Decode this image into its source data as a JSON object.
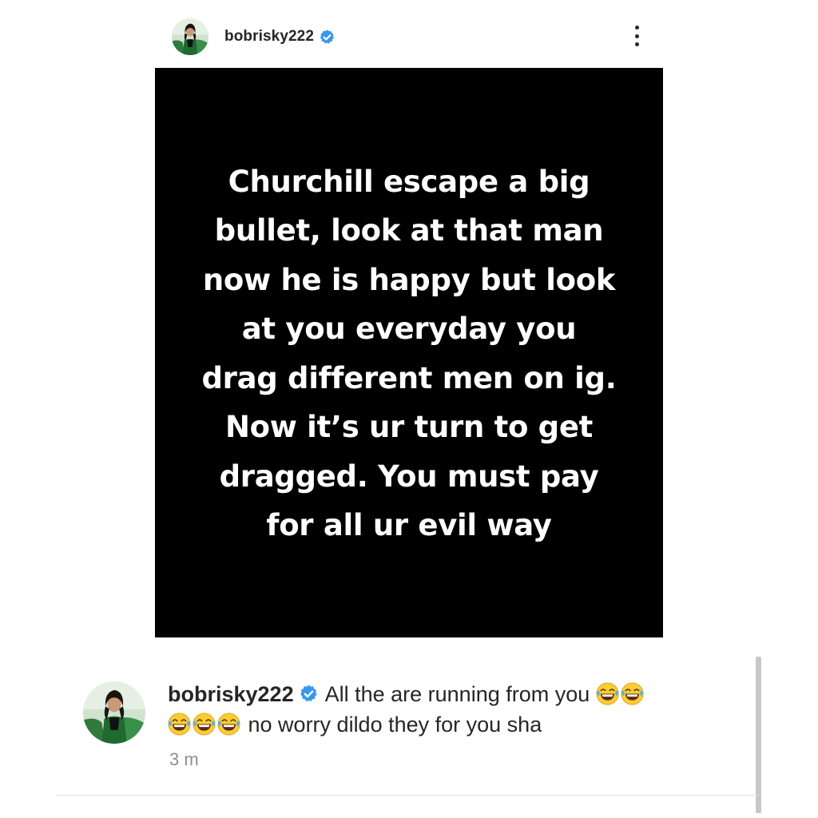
{
  "post": {
    "username": "bobrisky222",
    "verified": true,
    "more_icon": "more-vertical-icon",
    "image_text": "Churchill escape a big\nbullet, look at that man\nnow he is happy but look\nat you everyday you\ndrag different men on ig.\nNow it’s ur turn to get\ndragged. You must pay\nfor all ur evil way",
    "image_background": "#000000",
    "image_text_color": "#ffffff"
  },
  "comment": {
    "username": "bobrisky222",
    "verified": true,
    "text_part1": "All the are running from you",
    "text_part2": "no worry dildo they for you sha",
    "emoji": "face-with-tears-of-joy",
    "timestamp": "3 m"
  },
  "colors": {
    "verified_badge": "#3897f0",
    "username": "#262626",
    "timestamp": "#8e8e8e"
  }
}
